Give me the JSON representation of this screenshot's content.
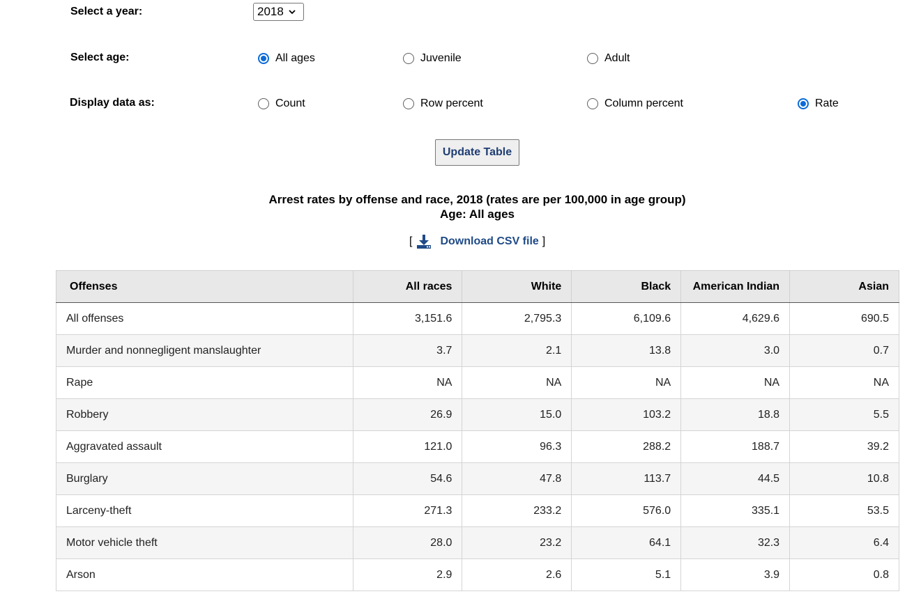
{
  "form": {
    "year_label": "Select a year:",
    "year_value": "2018",
    "age_label": "Select age:",
    "age_options": [
      "All ages",
      "Juvenile",
      "Adult"
    ],
    "age_selected": "All ages",
    "display_label": "Display data as:",
    "display_options": [
      "Count",
      "Row percent",
      "Column percent",
      "Rate"
    ],
    "display_selected": "Rate",
    "update_button": "Update Table"
  },
  "table_title": {
    "line1": "Arrest rates by offense and race, 2018 (rates are per 100,000 in age group)",
    "line2": "Age: All ages"
  },
  "download": {
    "open_bracket": "[",
    "label": "Download CSV file",
    "close_bracket": "]"
  },
  "table": {
    "headers": [
      "Offenses",
      "All races",
      "White",
      "Black",
      "American Indian",
      "Asian"
    ],
    "rows": [
      [
        "All offenses",
        "3,151.6",
        "2,795.3",
        "6,109.6",
        "4,629.6",
        "690.5"
      ],
      [
        "Murder and nonnegligent manslaughter",
        "3.7",
        "2.1",
        "13.8",
        "3.0",
        "0.7"
      ],
      [
        "Rape",
        "NA",
        "NA",
        "NA",
        "NA",
        "NA"
      ],
      [
        "Robbery",
        "26.9",
        "15.0",
        "103.2",
        "18.8",
        "5.5"
      ],
      [
        "Aggravated assault",
        "121.0",
        "96.3",
        "288.2",
        "188.7",
        "39.2"
      ],
      [
        "Burglary",
        "54.6",
        "47.8",
        "113.7",
        "44.5",
        "10.8"
      ],
      [
        "Larceny-theft",
        "271.3",
        "233.2",
        "576.0",
        "335.1",
        "53.5"
      ],
      [
        "Motor vehicle theft",
        "28.0",
        "23.2",
        "64.1",
        "32.3",
        "6.4"
      ],
      [
        "Arson",
        "2.9",
        "2.6",
        "5.1",
        "3.9",
        "0.8"
      ]
    ]
  },
  "colors": {
    "radio_accent": "#0b6bd8",
    "link": "#1f4a87",
    "header_bg": "#e8e8e8"
  }
}
